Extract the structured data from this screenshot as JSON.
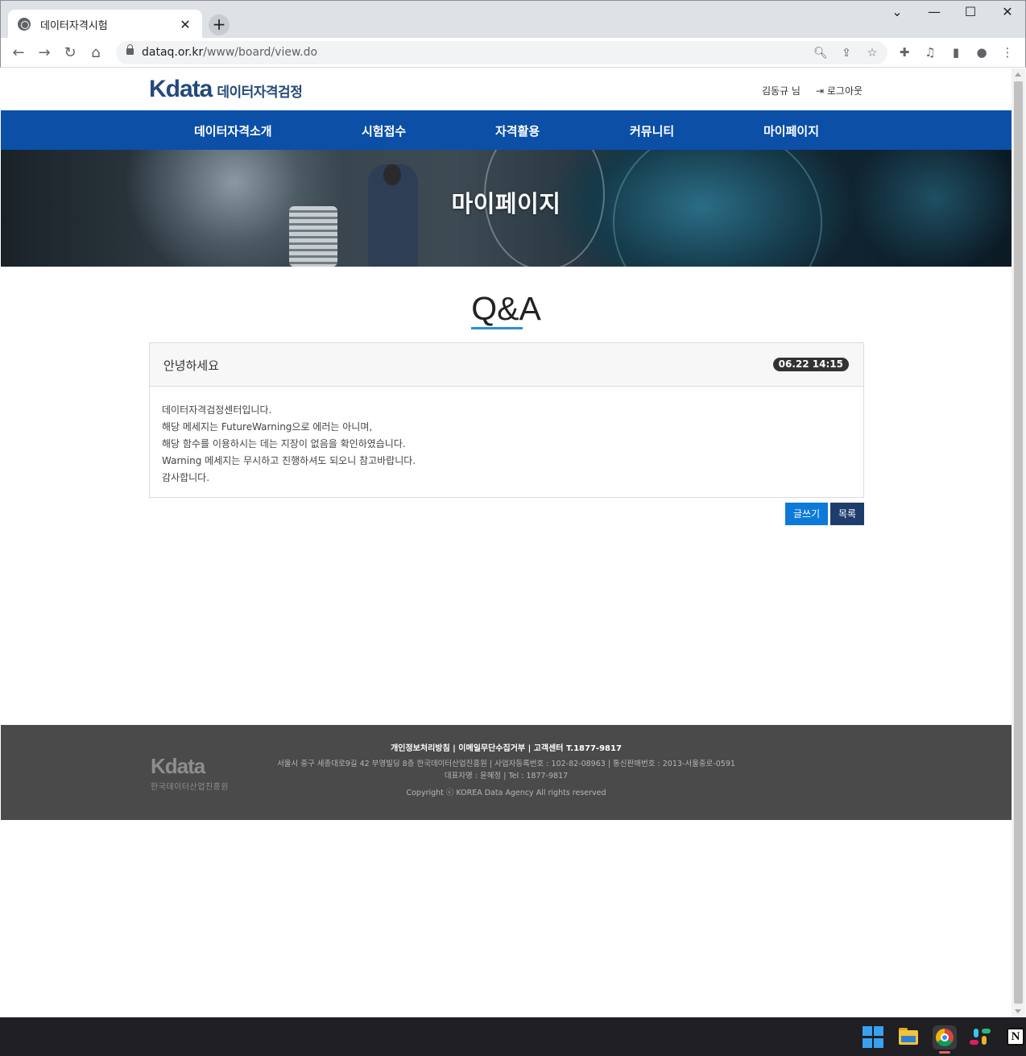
{
  "browser": {
    "tab_title": "데이터자격시험",
    "tab_close": "✕",
    "new_tab": "+",
    "url_host": "dataq.or.kr",
    "url_path": "/www/board/view.do",
    "window_controls": [
      "minimize-icon",
      "maximize-icon",
      "close-icon"
    ]
  },
  "site": {
    "logo_text": "Kdata",
    "logo_korean": "데이터자격검정",
    "user_name": "김동규 님",
    "logout_label": "로그아웃",
    "brand_color": "#0b4fa6"
  },
  "gnb": {
    "items": [
      {
        "label": "데이터자격소개"
      },
      {
        "label": "시험접수"
      },
      {
        "label": "자격활용"
      },
      {
        "label": "커뮤니티"
      },
      {
        "label": "마이페이지"
      }
    ]
  },
  "hero": {
    "title": "마이페이지"
  },
  "page": {
    "title": "Q&A"
  },
  "post": {
    "subject": "안녕하세요",
    "date": "06.22 14:15",
    "body_lines": [
      "데이터자격검정센터입니다.",
      "해당 메세지는 FutureWarning으로 에러는 아니며,",
      "해당 함수를 이용하시는 데는 지장이 없음을 확인하였습니다.",
      "Warning 메세지는 무시하고 진행하셔도 되오니 참고바랍니다.",
      "감사합니다."
    ]
  },
  "buttons": {
    "write": "글쓰기",
    "list": "목록"
  },
  "footer": {
    "links": "개인정보처리방침  |  이메일무단수집거부  |  고객센터 T.1877-9817",
    "address": "서울시 중구 세종대로9길 42 부영빌딩 8층 한국데이터산업진흥원  |  사업자등록번호 : 102-82-08963  |  통신판매번호 : 2013-서울중로-0591",
    "representative": "대표자명 : 윤혜정  |  Tel : 1877-9817",
    "copyright": "Copyright ⓒ KOREA Data Agency All rights reserved",
    "logo_text": "Kdata",
    "logo_sub": "한국데이터산업진흥원"
  }
}
